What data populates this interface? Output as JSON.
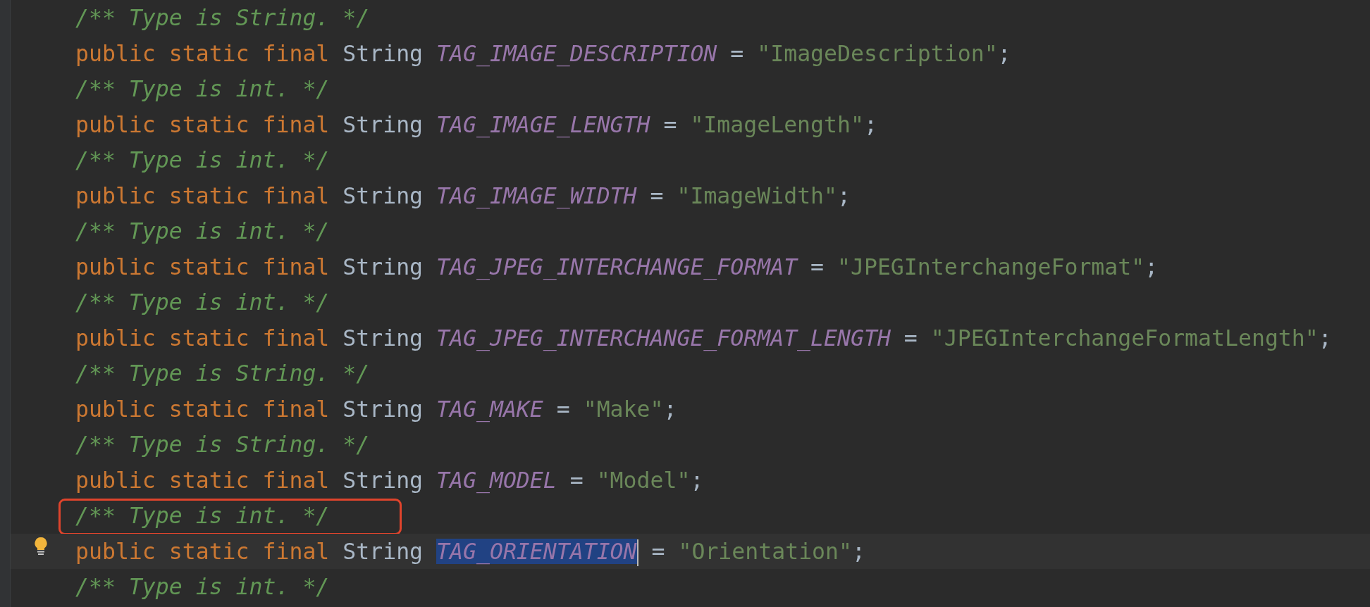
{
  "editor": {
    "lines": [
      {
        "kind": "comment",
        "text": "/** Type is String. */",
        "outlined": false
      },
      {
        "kind": "declaration",
        "keywords": "public static final",
        "type": "String",
        "name": "TAG_IMAGE_DESCRIPTION",
        "operator": "=",
        "value": "\"ImageDescription\"",
        "terminator": ";",
        "current": false,
        "name_selected": false,
        "bulb": false
      },
      {
        "kind": "comment",
        "text": "/** Type is int. */",
        "outlined": false
      },
      {
        "kind": "declaration",
        "keywords": "public static final",
        "type": "String",
        "name": "TAG_IMAGE_LENGTH",
        "operator": "=",
        "value": "\"ImageLength\"",
        "terminator": ";",
        "current": false,
        "name_selected": false,
        "bulb": false
      },
      {
        "kind": "comment",
        "text": "/** Type is int. */",
        "outlined": false
      },
      {
        "kind": "declaration",
        "keywords": "public static final",
        "type": "String",
        "name": "TAG_IMAGE_WIDTH",
        "operator": "=",
        "value": "\"ImageWidth\"",
        "terminator": ";",
        "current": false,
        "name_selected": false,
        "bulb": false
      },
      {
        "kind": "comment",
        "text": "/** Type is int. */",
        "outlined": false
      },
      {
        "kind": "declaration",
        "keywords": "public static final",
        "type": "String",
        "name": "TAG_JPEG_INTERCHANGE_FORMAT",
        "operator": "=",
        "value": "\"JPEGInterchangeFormat\"",
        "terminator": ";",
        "current": false,
        "name_selected": false,
        "bulb": false
      },
      {
        "kind": "comment",
        "text": "/** Type is int. */",
        "outlined": false
      },
      {
        "kind": "declaration",
        "keywords": "public static final",
        "type": "String",
        "name": "TAG_JPEG_INTERCHANGE_FORMAT_LENGTH",
        "operator": "=",
        "value": "\"JPEGInterchangeFormatLength\"",
        "terminator": ";",
        "current": false,
        "name_selected": false,
        "bulb": false
      },
      {
        "kind": "comment",
        "text": "/** Type is String. */",
        "outlined": false
      },
      {
        "kind": "declaration",
        "keywords": "public static final",
        "type": "String",
        "name": "TAG_MAKE",
        "operator": "=",
        "value": "\"Make\"",
        "terminator": ";",
        "current": false,
        "name_selected": false,
        "bulb": false
      },
      {
        "kind": "comment",
        "text": "/** Type is String. */",
        "outlined": false
      },
      {
        "kind": "declaration",
        "keywords": "public static final",
        "type": "String",
        "name": "TAG_MODEL",
        "operator": "=",
        "value": "\"Model\"",
        "terminator": ";",
        "current": false,
        "name_selected": false,
        "bulb": false
      },
      {
        "kind": "comment",
        "text": "/** Type is int. */",
        "outlined": true
      },
      {
        "kind": "declaration",
        "keywords": "public static final",
        "type": "String",
        "name": "TAG_ORIENTATION",
        "operator": "=",
        "value": "\"Orientation\"",
        "terminator": ";",
        "current": true,
        "name_selected": true,
        "bulb": true
      },
      {
        "kind": "comment",
        "text": "/** Type is int. */",
        "outlined": false
      }
    ]
  }
}
